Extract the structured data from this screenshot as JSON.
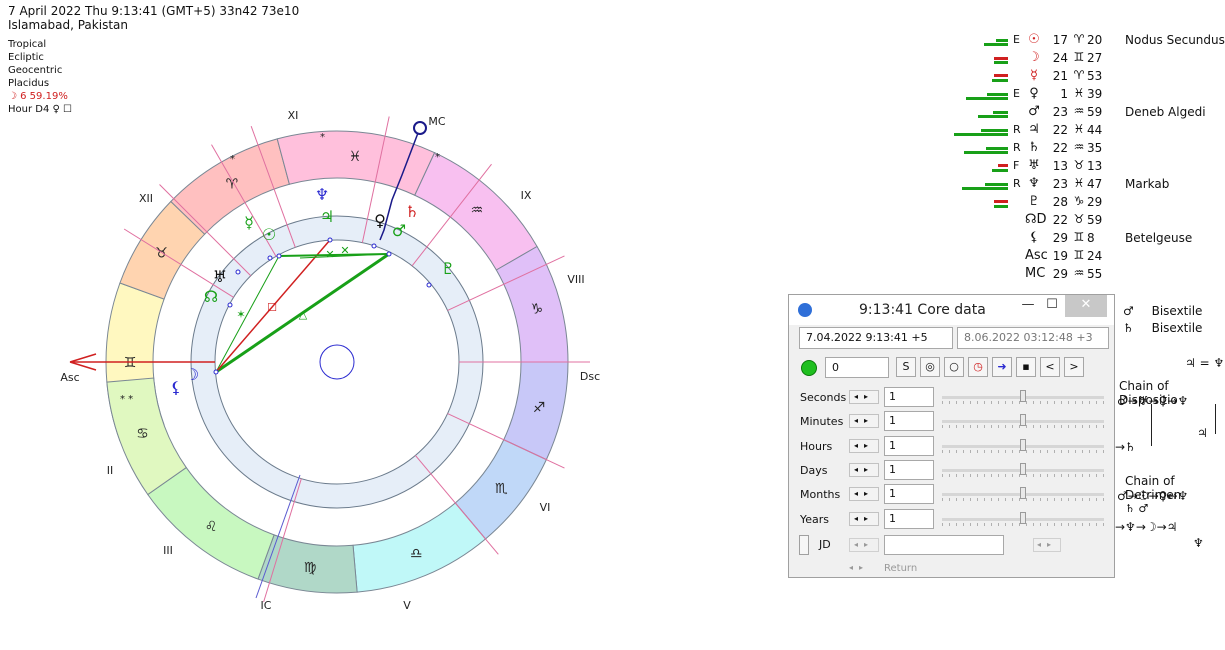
{
  "header": {
    "line1": "7 April 2022  Thu   9:13:41 (GMT+5) 33n42  73e10",
    "line2": "Islamabad, Pakistan"
  },
  "info": {
    "zodiac": "Tropical",
    "coords": "Ecliptic",
    "centric": "Geocentric",
    "houses": "Placidus",
    "moon_phase": "☽  6 59.19%",
    "hour": "Hour D4  ♀  ☐"
  },
  "wheel": {
    "houses": [
      "Asc",
      "II",
      "III",
      "IC",
      "V",
      "VI",
      "Dsc",
      "VIII",
      "IX",
      "MC",
      "XI",
      "XII"
    ],
    "signs": [
      "♈",
      "♉",
      "♊",
      "♋",
      "♌",
      "♍",
      "♎",
      "♏",
      "♐",
      "♑",
      "♒",
      "♓"
    ],
    "stars_marks": [
      "*",
      "*",
      "*",
      "* *"
    ],
    "planets_on_wheel": [
      {
        "glyph": "♆",
        "color": "#2a2ad0"
      },
      {
        "glyph": "♃",
        "color": "#18a018"
      },
      {
        "glyph": "♀",
        "color": "#111111"
      },
      {
        "glyph": "♂",
        "color": "#18a018"
      },
      {
        "glyph": "♄",
        "color": "#d02020"
      },
      {
        "glyph": "☿",
        "color": "#18a018"
      },
      {
        "glyph": "☉",
        "color": "#18a018"
      },
      {
        "glyph": "♅",
        "color": "#111111"
      },
      {
        "glyph": "☊",
        "color": "#18a018"
      },
      {
        "glyph": "☽",
        "color": "#2a2ad0"
      },
      {
        "glyph": "⚸",
        "color": "#2a2ad0"
      },
      {
        "glyph": "♇",
        "color": "#18a018"
      }
    ],
    "aspect_symbols": [
      "✕",
      "✕",
      "△",
      "☐",
      "✶"
    ]
  },
  "planets": [
    {
      "bar_red": 0,
      "bar_green": 24,
      "flag": "E",
      "glyph": "☉",
      "glyph_color": "#d02020",
      "deg": "17",
      "sign": "♈",
      "min": "20",
      "star": "Nodus Secundus"
    },
    {
      "bar_red": 14,
      "bar_green": 0,
      "flag": "",
      "glyph": "☽",
      "glyph_color": "#d02020",
      "deg": "24",
      "sign": "♊",
      "min": "27",
      "star": ""
    },
    {
      "bar_red": 14,
      "bar_green": 16,
      "flag": "",
      "glyph": "☿",
      "glyph_color": "#d02020",
      "deg": "21",
      "sign": "♈",
      "min": "53",
      "star": ""
    },
    {
      "bar_red": 0,
      "bar_green": 42,
      "flag": "E",
      "glyph": "♀",
      "glyph_color": "#111111",
      "deg": "1",
      "sign": "♓",
      "min": "39",
      "star": ""
    },
    {
      "bar_red": 0,
      "bar_green": 30,
      "flag": "",
      "glyph": "♂",
      "glyph_color": "#111111",
      "deg": "23",
      "sign": "♒",
      "min": "59",
      "star": "Deneb Algedi"
    },
    {
      "bar_red": 0,
      "bar_green": 54,
      "flag": "R",
      "glyph": "♃",
      "glyph_color": "#111111",
      "deg": "22",
      "sign": "♓",
      "min": "44",
      "star": ""
    },
    {
      "bar_red": 0,
      "bar_green": 44,
      "flag": "R",
      "glyph": "♄",
      "glyph_color": "#111111",
      "deg": "22",
      "sign": "♒",
      "min": "35",
      "star": ""
    },
    {
      "bar_red": 10,
      "bar_green": 16,
      "flag": "F",
      "glyph": "♅",
      "glyph_color": "#111111",
      "deg": "13",
      "sign": "♉",
      "min": "13",
      "star": ""
    },
    {
      "bar_red": 0,
      "bar_green": 46,
      "flag": "R",
      "glyph": "♆",
      "glyph_color": "#111111",
      "deg": "23",
      "sign": "♓",
      "min": "47",
      "star": "Markab"
    },
    {
      "bar_red": 14,
      "bar_green": 14,
      "flag": "",
      "glyph": "♇",
      "glyph_color": "#111111",
      "deg": "28",
      "sign": "♑",
      "min": "29",
      "star": ""
    },
    {
      "bar_red": 0,
      "bar_green": 0,
      "flag": "",
      "glyph": "☊D",
      "glyph_color": "#111111",
      "deg": "22",
      "sign": "♉",
      "min": "59",
      "star": ""
    },
    {
      "bar_red": 0,
      "bar_green": 0,
      "flag": "",
      "glyph": "⚸",
      "glyph_color": "#111111",
      "deg": "29",
      "sign": "♊",
      "min": "8",
      "star": "Betelgeuse"
    },
    {
      "bar_red": 0,
      "bar_green": 0,
      "flag": "",
      "glyph": "Asc",
      "glyph_color": "#111111",
      "deg": "19",
      "sign": "♊",
      "min": "24",
      "star": ""
    },
    {
      "bar_red": 0,
      "bar_green": 0,
      "flag": "",
      "glyph": "MC",
      "glyph_color": "#111111",
      "deg": "29",
      "sign": "♒",
      "min": "55",
      "star": ""
    }
  ],
  "right_panel": {
    "bisextile": [
      {
        "glyph": "♂",
        "label": "Bisextile"
      },
      {
        "glyph": "♄",
        "label": "Bisextile"
      }
    ],
    "jup_nep": "♃ = ♆",
    "chain_disp_title": "Chain of Dispositio",
    "chain_disp_1": "♂→♅→♀→♆",
    "chain_disp_2": "♃",
    "chain_disp_3": "→♄",
    "chain_det_title": "Chain of Detrimen",
    "chain_det_1": "♂→☉→♀↔♆",
    "chain_det_2": "♄ ♂",
    "chain_det_3": "→♆→☽→♃",
    "chain_det_4": "♆"
  },
  "window": {
    "title": "9:13:41 Core data",
    "min_label": "—",
    "max_label": "☐",
    "close_label": "✕",
    "date1": "7.04.2022  9:13:41  +5",
    "date2": "8.06.2022  03:12:48  +3",
    "counter": "0",
    "rows": [
      {
        "label": "Seconds",
        "value": "1",
        "thumb": 0.5
      },
      {
        "label": "Minutes",
        "value": "1",
        "thumb": 0.5
      },
      {
        "label": "Hours",
        "value": "1",
        "thumb": 0.5
      },
      {
        "label": "Days",
        "value": "1",
        "thumb": 0.5
      },
      {
        "label": "Months",
        "value": "1",
        "thumb": 0.5
      },
      {
        "label": "Years",
        "value": "1",
        "thumb": 0.5
      }
    ],
    "jd_label": "JD",
    "jd_value": "",
    "return_label": "Return",
    "nav_prev": "<",
    "nav_next": ">"
  }
}
